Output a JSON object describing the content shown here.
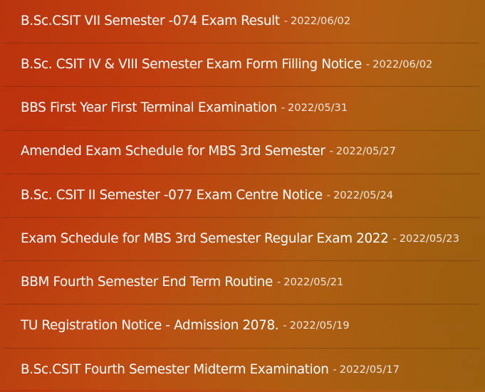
{
  "notices": {
    "separator": "-",
    "items": [
      {
        "title": "B.Sc.CSIT VII Semester -074 Exam Result",
        "date": "2022/06/02"
      },
      {
        "title": "B.Sc. CSIT IV & VIII Semester Exam Form Filling Notice",
        "date": "2022/06/02"
      },
      {
        "title": "BBS First Year First Terminal Examination",
        "date": "2022/05/31"
      },
      {
        "title": "Amended Exam Schedule for MBS 3rd Semester",
        "date": "2022/05/27"
      },
      {
        "title": "B.Sc. CSIT II Semester -077 Exam Centre Notice",
        "date": "2022/05/24"
      },
      {
        "title": "Exam Schedule for MBS 3rd Semester Regular Exam 2022",
        "date": "2022/05/23"
      },
      {
        "title": "BBM Fourth Semester End Term Routine",
        "date": "2022/05/21"
      },
      {
        "title": "TU Registration Notice - Admission 2078.",
        "date": "2022/05/19"
      },
      {
        "title": "B.Sc.CSIT Fourth Semester Midterm Examination",
        "date": "2022/05/17"
      }
    ]
  }
}
